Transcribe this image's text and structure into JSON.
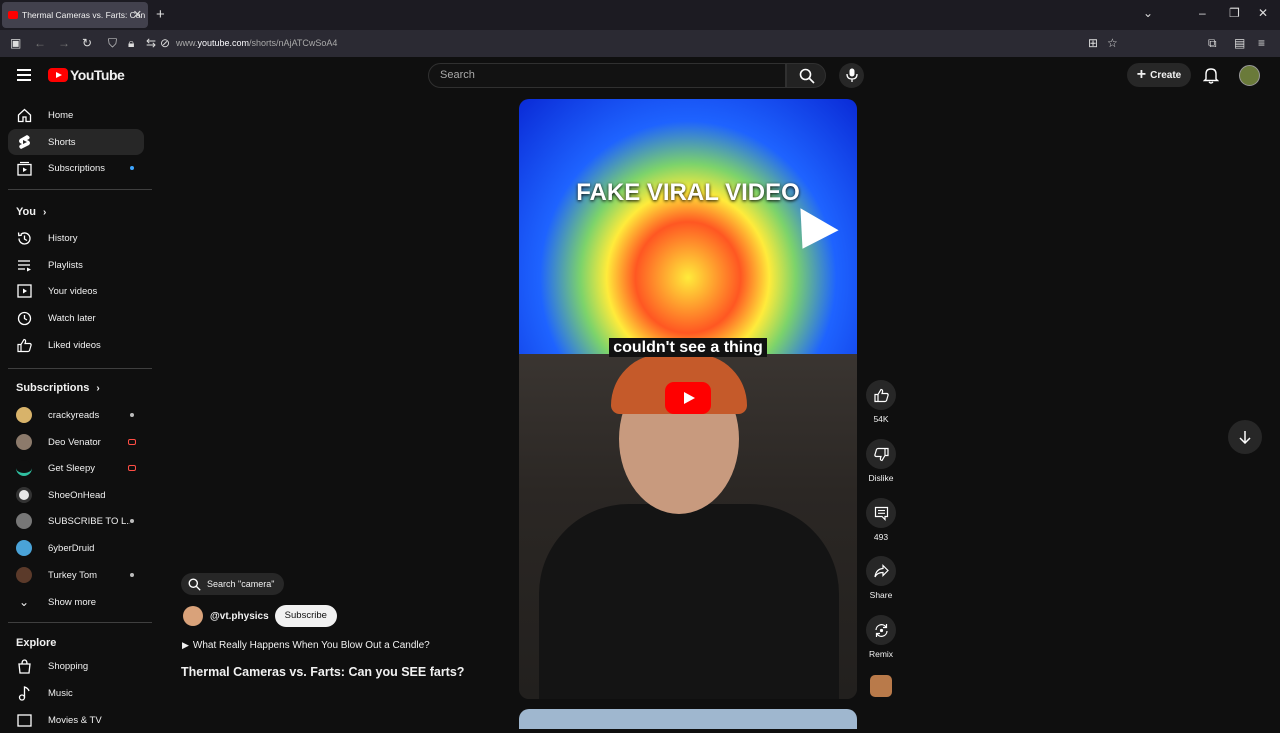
{
  "browser": {
    "tab_title": "Thermal Cameras vs. Farts: Can",
    "new_tab": "+",
    "url_prefix": "www.",
    "url_domain": "youtube.com",
    "url_path": "/shorts/nAjATCwSoA4"
  },
  "header": {
    "logo_text": "YouTube",
    "search_placeholder": "Search",
    "create_label": "Create"
  },
  "sidebar": {
    "main": [
      {
        "label": "Home",
        "icon": "home-icon"
      },
      {
        "label": "Shorts",
        "icon": "shorts-icon"
      },
      {
        "label": "Subscriptions",
        "icon": "subscriptions-icon"
      }
    ],
    "you_heading": "You",
    "you_items": [
      {
        "label": "History",
        "icon": "history-icon"
      },
      {
        "label": "Playlists",
        "icon": "playlists-icon"
      },
      {
        "label": "Your videos",
        "icon": "your-videos-icon"
      },
      {
        "label": "Watch later",
        "icon": "watch-later-icon"
      },
      {
        "label": "Liked videos",
        "icon": "liked-videos-icon"
      }
    ],
    "subs_heading": "Subscriptions",
    "subscriptions": [
      {
        "label": "crackyreads",
        "status": "new"
      },
      {
        "label": "Deo Venator",
        "status": "live"
      },
      {
        "label": "Get Sleepy",
        "status": "live"
      },
      {
        "label": "ShoeOnHead",
        "status": ""
      },
      {
        "label": "SUBSCRIBE TO L...",
        "status": "new"
      },
      {
        "label": "6yberDruid",
        "status": ""
      },
      {
        "label": "Turkey Tom",
        "status": "new"
      }
    ],
    "show_more": "Show more",
    "explore_heading": "Explore",
    "explore_items": [
      {
        "label": "Shopping",
        "icon": "shopping-icon"
      },
      {
        "label": "Music",
        "icon": "music-icon"
      },
      {
        "label": "Movies & TV",
        "icon": "movies-icon"
      }
    ]
  },
  "short": {
    "overlay_text": "FAKE VIRAL VIDEO",
    "caption": "couldn't see a thing",
    "search_pill": "Search \"camera\"",
    "channel": "@vt.physics",
    "subscribe": "Subscribe",
    "related": "What Really Happens When You Blow Out a Candle?",
    "title": "Thermal Cameras vs. Farts: Can you SEE farts?"
  },
  "actions": {
    "likes": "54K",
    "dislike": "Dislike",
    "comments": "493",
    "share": "Share",
    "remix": "Remix"
  }
}
